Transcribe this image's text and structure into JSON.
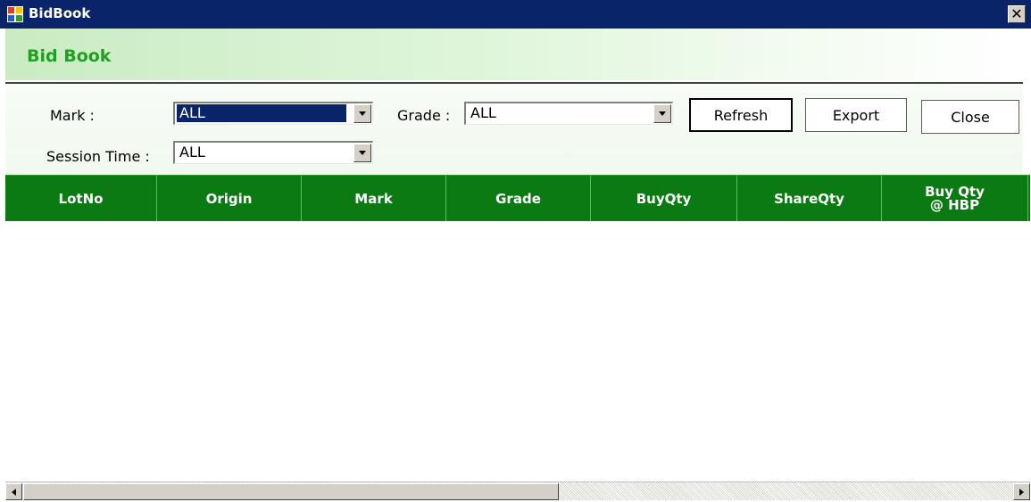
{
  "window": {
    "title": "BidBook",
    "close_glyph": "✕",
    "icon": "app-window-icon",
    "title_bar_color": "#0a246a"
  },
  "banner": {
    "title": "Bid Book",
    "title_color": "#229e22"
  },
  "filters": {
    "mark_label": "Mark :",
    "mark_value": "ALL",
    "grade_label": "Grade :",
    "grade_value": "ALL",
    "session_label": "Session Time :",
    "session_value": "ALL"
  },
  "buttons": {
    "refresh": "Refresh",
    "export": "Export",
    "close": "Close"
  },
  "grid": {
    "header_color": "#0b7a12",
    "columns": [
      "LotNo",
      "Origin",
      "Mark",
      "Grade",
      "BuyQty",
      "ShareQty",
      "Buy Qty @ HBP"
    ],
    "rows": []
  }
}
